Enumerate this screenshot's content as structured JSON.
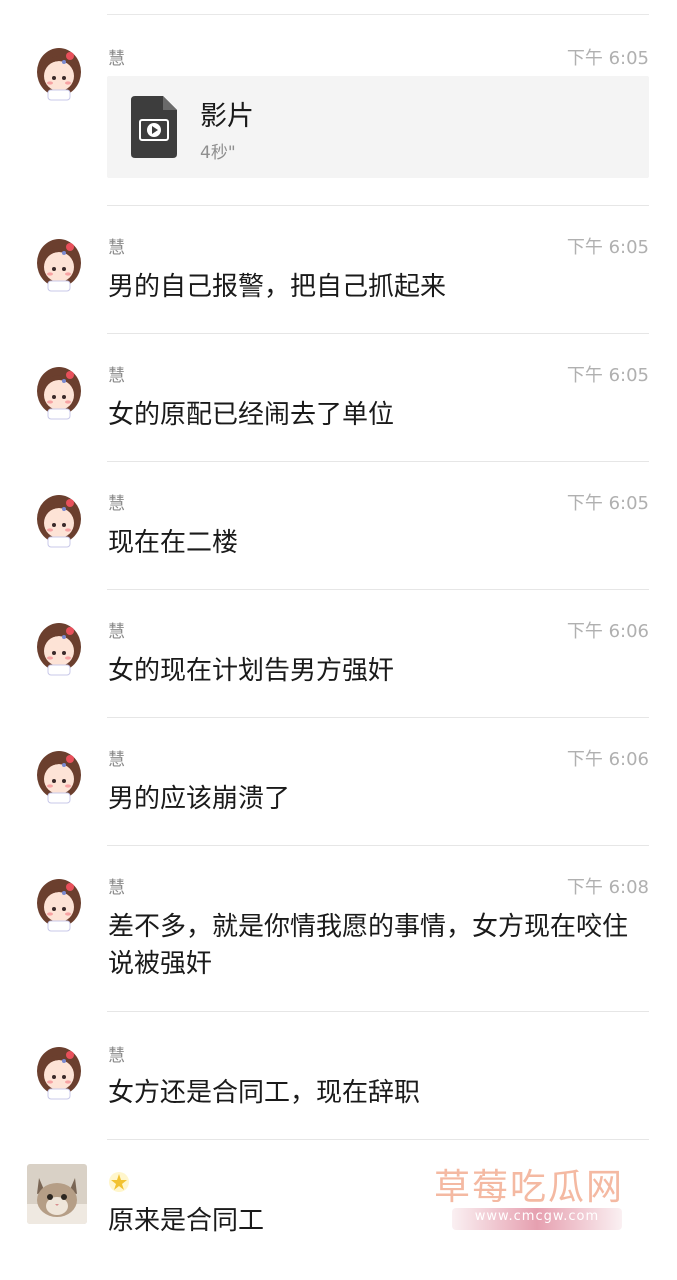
{
  "messages": [
    {
      "sender": "慧",
      "time": "下午 6:05",
      "type": "video",
      "video_title": "影片",
      "video_duration": "4秒\""
    },
    {
      "sender": "慧",
      "time": "下午 6:05",
      "text": "男的自己报警，把自己抓起来"
    },
    {
      "sender": "慧",
      "time": "下午 6:05",
      "text": "女的原配已经闹去了单位"
    },
    {
      "sender": "慧",
      "time": "下午 6:05",
      "text": "现在在二楼"
    },
    {
      "sender": "慧",
      "time": "下午 6:06",
      "text": "女的现在计划告男方强奸"
    },
    {
      "sender": "慧",
      "time": "下午 6:06",
      "text": "男的应该崩溃了"
    },
    {
      "sender": "慧",
      "time": "下午 6:08",
      "text": "差不多，就是你情我愿的事情，女方现在咬住说被强奸"
    },
    {
      "sender": "慧",
      "time": "",
      "text": "女方还是合同工，现在辞职"
    },
    {
      "sender": "",
      "time": "",
      "text": "原来是合同工"
    }
  ],
  "watermark": {
    "title": "草莓吃瓜网",
    "url": "www.cmcgw.com"
  },
  "colors": {
    "background": "#ffffff",
    "divider": "#e6e6e6",
    "time": "#b0b0b0",
    "watermark": "#f4b9a2"
  },
  "icons": [
    "girl-avatar-icon",
    "video-file-icon",
    "cat-avatar-icon",
    "star-badge-icon"
  ]
}
